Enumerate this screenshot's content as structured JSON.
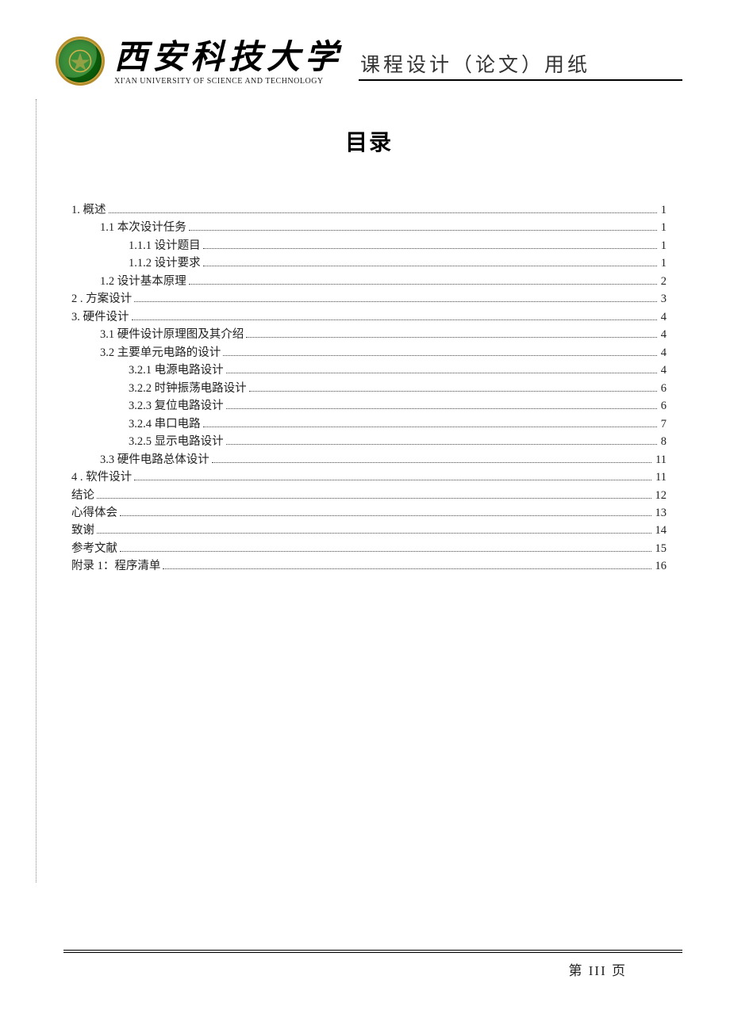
{
  "header": {
    "university_cn": "西安科技大学",
    "university_en": "XI'AN UNIVERSITY OF SCIENCE AND TECHNOLOGY",
    "doc_type": "课程设计（论文）用纸"
  },
  "toc_title": "目录",
  "toc": [
    {
      "level": 1,
      "label": "1.  概述",
      "page": "1"
    },
    {
      "level": 2,
      "label": "1.1 本次设计任务",
      "page": "1"
    },
    {
      "level": 3,
      "label": "1.1.1 设计题目",
      "page": "1"
    },
    {
      "level": 3,
      "label": "1.1.2 设计要求",
      "page": "1"
    },
    {
      "level": 2,
      "label": "1.2 设计基本原理",
      "page": "2"
    },
    {
      "level": 1,
      "label": "2 . 方案设计",
      "page": "3"
    },
    {
      "level": 1,
      "label": "3.  硬件设计",
      "page": "4"
    },
    {
      "level": 2,
      "label": "3.1 硬件设计原理图及其介绍",
      "page": "4"
    },
    {
      "level": 2,
      "label": "3.2 主要单元电路的设计",
      "page": "4"
    },
    {
      "level": 3,
      "label": "3.2.1 电源电路设计",
      "page": "4"
    },
    {
      "level": 3,
      "label": "3.2.2 时钟振荡电路设计",
      "page": "6"
    },
    {
      "level": 3,
      "label": "3.2.3 复位电路设计",
      "page": "6"
    },
    {
      "level": 3,
      "label": "3.2.4 串口电路",
      "page": "7"
    },
    {
      "level": 3,
      "label": "3.2.5 显示电路设计",
      "page": "8"
    },
    {
      "level": 2,
      "label": "3.3 硬件电路总体设计",
      "page": "11"
    },
    {
      "level": 1,
      "label": "4 . 软件设计",
      "page": "11"
    },
    {
      "level": 1,
      "label": "结论",
      "page": "12"
    },
    {
      "level": 1,
      "label": "心得体会",
      "page": "13"
    },
    {
      "level": 1,
      "label": "致谢",
      "page": "14"
    },
    {
      "level": 1,
      "label": "参考文献",
      "page": "15"
    },
    {
      "level": 1,
      "label": "附录 1：程序清单",
      "page": "16"
    }
  ],
  "footer": {
    "page_label": "第  III  页"
  }
}
